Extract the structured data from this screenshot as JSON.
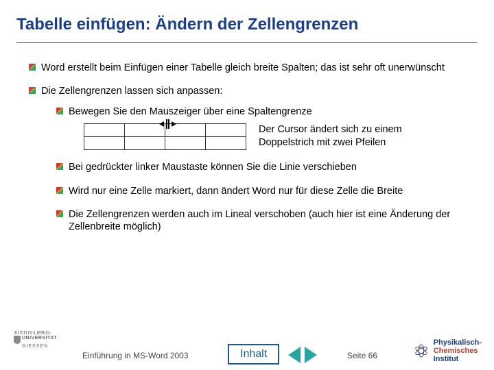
{
  "title": "Tabelle einfügen: Ändern der Zellengrenzen",
  "bullets": {
    "b1": "Word erstellt beim Einfügen einer Tabelle gleich breite Spalten; das ist sehr oft unerwünscht",
    "b2": "Die Zellengrenzen lassen sich anpassen:",
    "sub": {
      "s1": "Bewegen Sie den Mauszeiger über eine Spaltengrenze",
      "cursor_desc": "Der Cursor ändert sich zu einem Doppelstrich mit zwei Pfeilen",
      "s2": "Bei gedrückter linker Maustaste können Sie die Linie verschieben",
      "s3": "Wird nur eine Zelle markiert, dann ändert Word nur für diese Zelle die Breite",
      "s4": "Die Zellengrenzen werden auch im Lineal verschoben (auch hier ist eine Änderung der Zellenbreite möglich)"
    }
  },
  "footer": {
    "left_logo": {
      "line1": "JUSTUS-LIEBIG-",
      "line2": "UNIVERSITAT",
      "line3": "GIESSEN"
    },
    "course": "Einführung in MS-Word 2003",
    "inhalt": "Inhalt",
    "page": "Seite 66",
    "right_logo": {
      "l1": "Physikalisch-",
      "l2": "Chemisches",
      "l3": "Institut"
    }
  }
}
